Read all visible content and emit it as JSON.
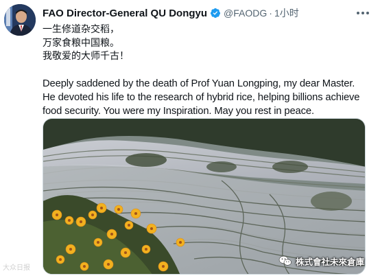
{
  "tweet": {
    "author_name": "FAO Director-General QU Dongyu",
    "handle": "@FAODG",
    "separator": "·",
    "time": "1小时",
    "lines_zh": [
      "一生修道杂交稻，",
      "万家食粮中国粮。",
      "我敬爱的大师千古！"
    ],
    "text_en": "Deeply saddened by the death of Prof Yuan Longping, my dear Master. He devoted his life to the research of hybrid rice, helping billions achieve food security. You were my Inspiration. May you rest in peace."
  },
  "icons": {
    "verified": "verified-badge-icon",
    "more": "more-options-icon",
    "watermark": "wechat-icon"
  },
  "colors": {
    "text": "#0f1419",
    "secondary": "#536471",
    "verified": "#1d9bf0"
  },
  "watermarks": {
    "left": "大众日报",
    "right": "株式會社未來倉庫"
  }
}
